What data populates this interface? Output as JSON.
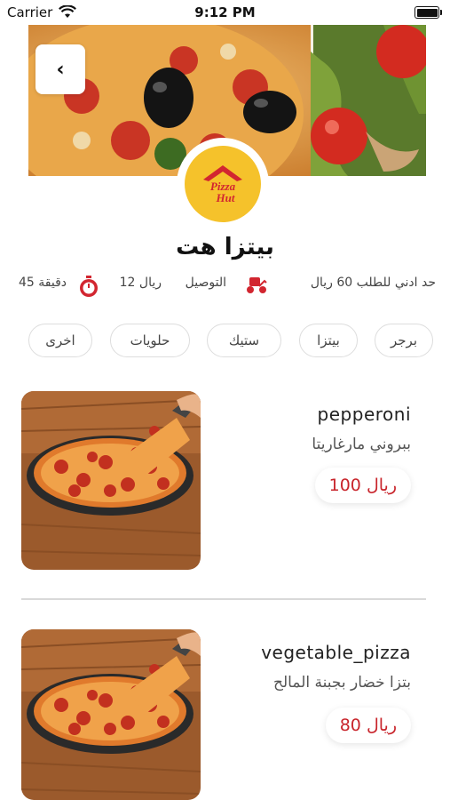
{
  "status_bar": {
    "carrier": "Carrier",
    "time": "9:12 PM"
  },
  "header": {
    "back_icon": "chevron-left-icon"
  },
  "restaurant": {
    "name": "بيتزا هت",
    "logo_alt": "Pizza Hut",
    "min_order": "حد ادني للطلب 60 ريال",
    "delivery_label": "التوصيل",
    "delivery_fee": "12 ريال",
    "delivery_time": "45 دقيقة"
  },
  "categories": [
    "برجر",
    "بيتزا",
    "ستيك",
    "حلويات",
    "اخرى"
  ],
  "menu_items": [
    {
      "name": "pepperoni",
      "description": "ببروني مارغاريتا",
      "price": "100 ريال"
    },
    {
      "name": "vegetable_pizza",
      "description": "بتزا خضار بجبنة المالح",
      "price": "80 ريال"
    }
  ],
  "colors": {
    "accent": "#c8242b",
    "logo_yellow": "#f5c22b"
  }
}
